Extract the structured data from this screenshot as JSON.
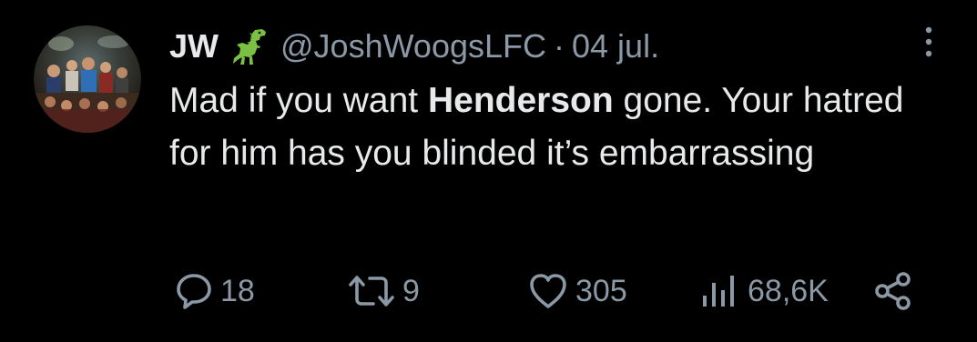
{
  "tweet": {
    "author": {
      "display_name": "JW",
      "badge_icon": "dinosaur-emoji",
      "handle": "@JoshWoogsLFC"
    },
    "separator": "·",
    "date": "04 jul.",
    "text": {
      "part1": "Mad if you want ",
      "bold": "Henderson",
      "part2": " gone.  Your hatred for him has you blinded it’s embarrassing"
    },
    "metrics": {
      "replies": "18",
      "reposts": "9",
      "likes": "305",
      "views": "68,6K"
    },
    "icons": [
      "more-icon",
      "reply-icon",
      "repost-icon",
      "like-icon",
      "views-icon",
      "share-icon"
    ]
  },
  "colors": {
    "background": "#000000",
    "primary_text": "#e7e9ea",
    "secondary_text": "#8b98a5",
    "badge": "#7bc043"
  }
}
